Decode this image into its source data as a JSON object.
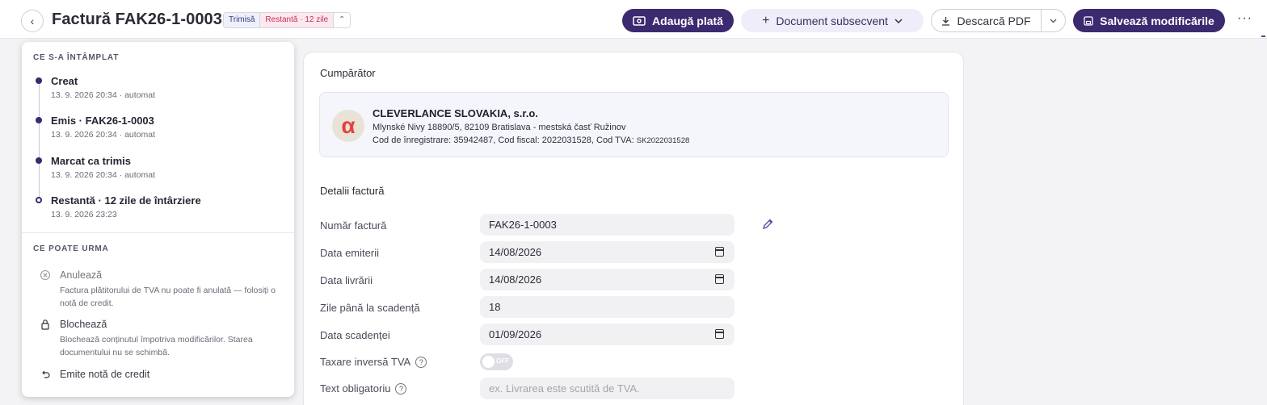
{
  "header": {
    "back_icon": "chevron-left-icon",
    "title": "Factură FAK26-1-0003",
    "badge_sent": "Trimisă",
    "badge_overdue": "Restantă · 12 zile",
    "actions": {
      "add_payment": "Adaugă plată",
      "subsequent_document": "Document subsecvent",
      "download_pdf": "Descarcă PDF",
      "save_changes": "Salvează modificările"
    }
  },
  "timeline": {
    "title": "CE S-A ÎNTÂMPLAT",
    "items": [
      {
        "label": "Creat",
        "meta": "13. 9. 2026 20:34 · automat"
      },
      {
        "label": "Emis · FAK26-1-0003",
        "meta": "13. 9. 2026 20:34 · automat"
      },
      {
        "label": "Marcat ca trimis",
        "meta": "13. 9. 2026 20:34 · automat"
      },
      {
        "label": "Restantă · 12 zile de întârziere",
        "meta": "13. 9. 2026 23:23"
      }
    ]
  },
  "next_steps": {
    "title": "CE POATE URMA",
    "items": [
      {
        "label": "Anulează",
        "desc": "Factura plătitorului de TVA nu poate fi anulată — folosiți o notă de credit.",
        "icon": "cancel-circle-icon"
      },
      {
        "label": "Blochează",
        "desc": "Blochează conținutul împotriva modificărilor. Starea documentului nu se schimbă.",
        "icon": "lock-icon"
      },
      {
        "label": "Emite notă de credit",
        "desc": "",
        "icon": "undo-icon"
      }
    ]
  },
  "buyer": {
    "heading": "Cumpărător",
    "logo_letter": "α",
    "name": "CLEVERLANCE SLOVAKIA, s.r.o.",
    "address": "Mlynské Nivy 18890/5, 82109 Bratislava - mestská časť Ružinov",
    "ids": "Cod de înregistrare: 35942487, Cod fiscal: 2022031528, Cod TVA: ",
    "vat_code": "SK2022031528"
  },
  "details": {
    "heading": "Detalii factură",
    "invoice_number_label": "Număr factură",
    "invoice_number": "FAK26-1-0003",
    "issue_date_label": "Data emiterii",
    "issue_date": "14/08/2026",
    "delivery_date_label": "Data livrării",
    "delivery_date": "14/08/2026",
    "days_due_label": "Zile până la scadență",
    "days_due": "18",
    "due_date_label": "Data scadenței",
    "due_date": "01/09/2026",
    "reverse_charge_label": "Taxare inversă TVA",
    "reverse_charge_state": "OFF",
    "mandatory_text_label": "Text obligatoriu",
    "mandatory_text_placeholder": "ex. Livrarea este scutită de TVA."
  }
}
